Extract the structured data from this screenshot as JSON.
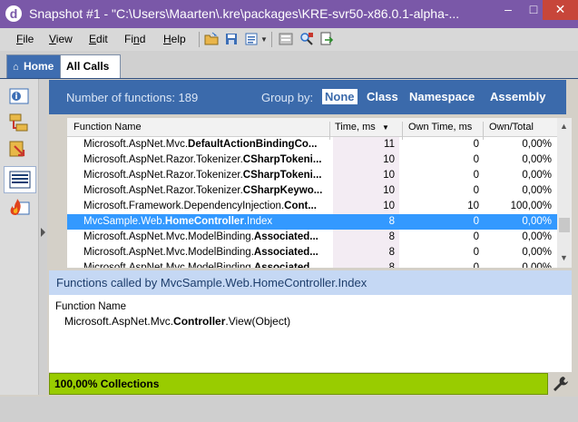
{
  "window": {
    "title": "Snapshot #1 - \"C:\\Users\\Maarten\\.kre\\packages\\KRE-svr50-x86.0.1-alpha-...",
    "app_icon": "dottrace-icon",
    "controls": {
      "minimize": "–",
      "maximize": "□",
      "close": "✕"
    }
  },
  "menu": [
    {
      "label": "File",
      "key": "F"
    },
    {
      "label": "View",
      "key": "V"
    },
    {
      "label": "Edit",
      "key": "E"
    },
    {
      "label": "Find",
      "key": "n"
    },
    {
      "label": "Help",
      "key": "H"
    }
  ],
  "tabs": {
    "home": "Home",
    "all_calls": "All Calls"
  },
  "groupby": {
    "count_text": "Number of functions: 189",
    "label": "Group by:",
    "options": [
      "None",
      "Class",
      "Namespace",
      "Assembly"
    ],
    "selected": "None"
  },
  "grid": {
    "headers": {
      "function": "Function Name",
      "time": "Time, ms",
      "own_time": "Own Time, ms",
      "own_total": "Own/Total"
    },
    "rows": [
      {
        "prefix": "Microsoft.AspNet.Mvc.",
        "bold": "DefaultActionBindingCo...",
        "time": "11",
        "own": "0",
        "ot": "0,00%"
      },
      {
        "prefix": "Microsoft.AspNet.Razor.Tokenizer.",
        "bold": "CSharpTokeni...",
        "time": "10",
        "own": "0",
        "ot": "0,00%"
      },
      {
        "prefix": "Microsoft.AspNet.Razor.Tokenizer.",
        "bold": "CSharpTokeni...",
        "time": "10",
        "own": "0",
        "ot": "0,00%"
      },
      {
        "prefix": "Microsoft.AspNet.Razor.Tokenizer.",
        "bold": "CSharpKeywo...",
        "time": "10",
        "own": "0",
        "ot": "0,00%"
      },
      {
        "prefix": "Microsoft.Framework.DependencyInjection.",
        "bold": "Cont...",
        "time": "10",
        "own": "10",
        "ot": "100,00%"
      },
      {
        "prefix": "MvcSample.Web.",
        "bold": "HomeController",
        "suffix": ".Index",
        "time": "8",
        "own": "0",
        "ot": "0,00%",
        "selected": true
      },
      {
        "prefix": "Microsoft.AspNet.Mvc.ModelBinding.",
        "bold": "Associated...",
        "time": "8",
        "own": "0",
        "ot": "0,00%"
      },
      {
        "prefix": "Microsoft.AspNet.Mvc.ModelBinding.",
        "bold": "Associated...",
        "time": "8",
        "own": "0",
        "ot": "0,00%"
      },
      {
        "prefix": "Microsoft.AspNet.Mvc.ModelBinding.",
        "bold": "Associated...",
        "time": "8",
        "own": "0",
        "ot": "0,00%"
      }
    ]
  },
  "callee": {
    "title": "Functions called by MvcSample.Web.HomeController.Index",
    "header": "Function Name",
    "item": {
      "prefix": "Microsoft.AspNet.Mvc.",
      "bold": "Controller",
      "suffix": ".View(Object)"
    }
  },
  "status": {
    "text": "100,00% Collections"
  },
  "colors": {
    "accent": "#3b6aab",
    "selection": "#3399ff",
    "status": "#99cc00",
    "titlebar": "#7a58a8"
  }
}
